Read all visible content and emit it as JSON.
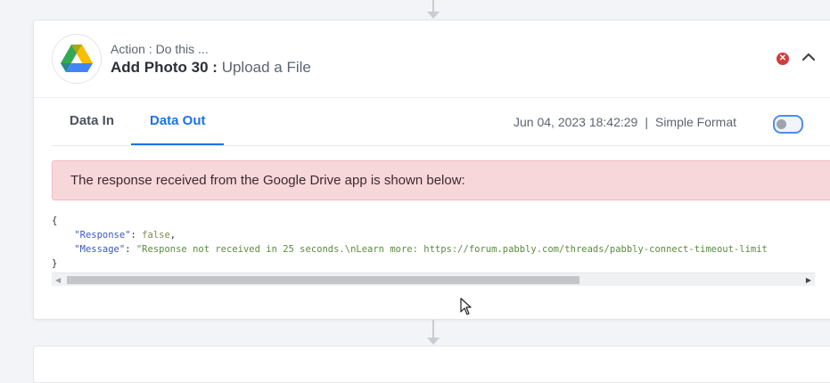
{
  "step": {
    "action_caption": "Action : Do this ...",
    "title": "Add Photo 30 :",
    "action_name": "Upload a File",
    "app_icon": "google-drive-icon"
  },
  "tabs": [
    {
      "label": "Data In",
      "active": false
    },
    {
      "label": "Data Out",
      "active": true
    }
  ],
  "meta": {
    "timestamp": "Jun 04, 2023 18:42:29",
    "separator": "|",
    "format_label": "Simple Format",
    "simple_format_enabled": false
  },
  "alert": {
    "message": "The response received from the Google Drive app is shown below:"
  },
  "response": {
    "open_brace": "{",
    "lines": [
      {
        "key": "\"Response\"",
        "value": "false",
        "trail": ","
      },
      {
        "key": "\"Message\"",
        "value": "\"Response not received in 25 seconds.\\nLearn more: https://forum.pabbly.com/threads/pabbly-connect-timeout-limit",
        "trail": ""
      }
    ],
    "close_brace": "}"
  },
  "scroll": {
    "thumb_fraction": 0.7
  },
  "colors": {
    "accent": "#1a73e8",
    "alert_bg": "#f8d7da",
    "delete_red": "#d23b3b"
  },
  "icons": {
    "delete": "delete-icon",
    "collapse": "chevron-up-icon",
    "scroll_left": "scroll-left-arrow-icon",
    "scroll_right": "scroll-right-arrow-icon",
    "cursor": "mouse-cursor-icon"
  }
}
